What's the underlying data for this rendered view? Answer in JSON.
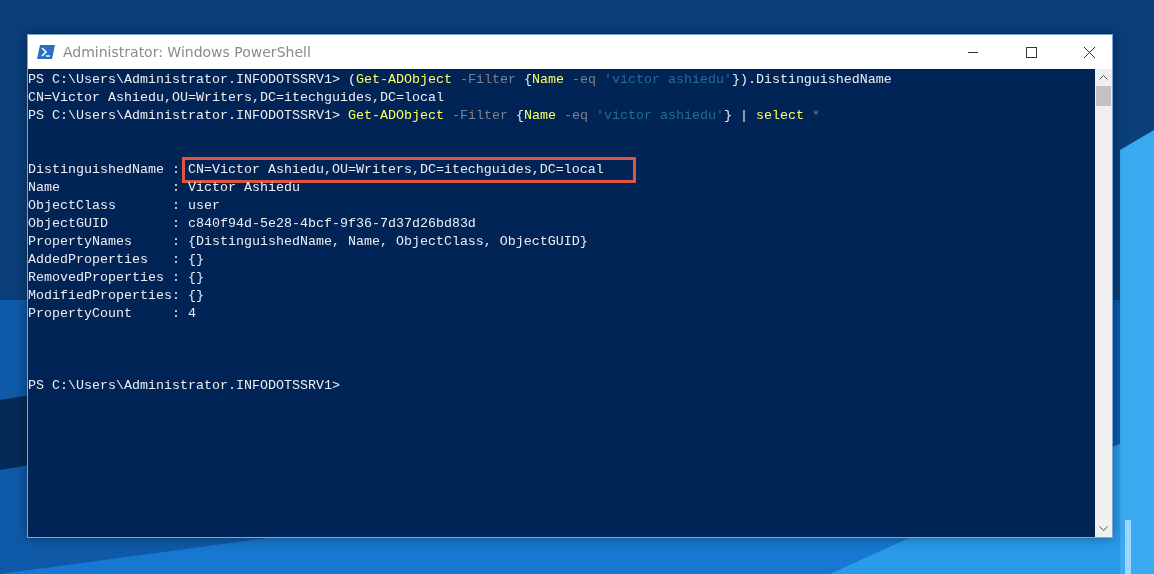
{
  "window": {
    "title": "Administrator: Windows PowerShell"
  },
  "console": {
    "lines": [
      {
        "kind": "command",
        "segments": [
          {
            "text": "PS C:\\Users\\Administrator.INFODOTSSRV1> ",
            "kind": "plain"
          },
          {
            "text": "(",
            "kind": "plain"
          },
          {
            "text": "Get-ADObject",
            "kind": "command"
          },
          {
            "text": " -Filter ",
            "kind": "parameter"
          },
          {
            "text": "{",
            "kind": "plain"
          },
          {
            "text": "Name",
            "kind": "command"
          },
          {
            "text": " -eq ",
            "kind": "parameter"
          },
          {
            "text": "'victor ashiedu'",
            "kind": "string"
          },
          {
            "text": "}).DistinguishedName",
            "kind": "plain"
          }
        ]
      },
      {
        "kind": "output",
        "text": "CN=Victor Ashiedu,OU=Writers,DC=itechguides,DC=local"
      },
      {
        "kind": "command",
        "segments": [
          {
            "text": "PS C:\\Users\\Administrator.INFODOTSSRV1> ",
            "kind": "plain"
          },
          {
            "text": "Get-ADObject",
            "kind": "command"
          },
          {
            "text": " -Filter ",
            "kind": "parameter"
          },
          {
            "text": "{",
            "kind": "plain"
          },
          {
            "text": "Name",
            "kind": "command"
          },
          {
            "text": " -eq ",
            "kind": "parameter"
          },
          {
            "text": "'victor ashiedu'",
            "kind": "string"
          },
          {
            "text": "} | ",
            "kind": "plain"
          },
          {
            "text": "select",
            "kind": "command"
          },
          {
            "text": " *",
            "kind": "parameter"
          }
        ]
      },
      {
        "kind": "properties",
        "rows": [
          {
            "name": "DistinguishedName",
            "separator": ":",
            "value": "CN=Victor Ashiedu,OU=Writers,DC=itechguides,DC=local",
            "highlighted": true
          },
          {
            "name": "Name",
            "separator": ":",
            "value": "Victor Ashiedu",
            "highlighted": false
          },
          {
            "name": "ObjectClass",
            "separator": ":",
            "value": "user",
            "highlighted": false
          },
          {
            "name": "ObjectGUID",
            "separator": ":",
            "value": "c840f94d-5e28-4bcf-9f36-7d37d26bd83d",
            "highlighted": false
          },
          {
            "name": "PropertyNames",
            "separator": ":",
            "value": "{DistinguishedName, Name, ObjectClass, ObjectGUID}",
            "highlighted": false
          },
          {
            "name": "AddedProperties",
            "separator": ":",
            "value": "{}",
            "highlighted": false
          },
          {
            "name": "RemovedProperties",
            "separator": ":",
            "value": "{}",
            "highlighted": false
          },
          {
            "name": "ModifiedProperties",
            "separator": ":",
            "value": "{}",
            "highlighted": false
          },
          {
            "name": "PropertyCount",
            "separator": ":",
            "value": "4",
            "highlighted": false
          }
        ]
      },
      {
        "kind": "prompt",
        "text": "PS C:\\Users\\Administrator.INFODOTSSRV1>"
      }
    ]
  }
}
